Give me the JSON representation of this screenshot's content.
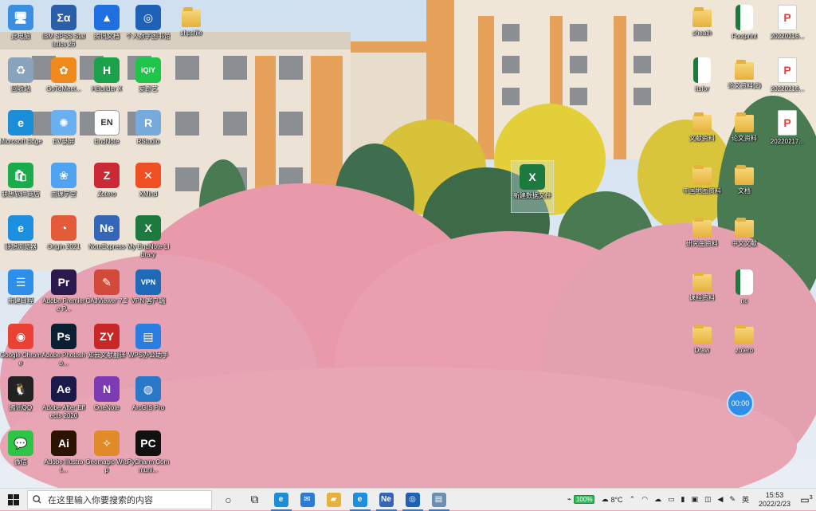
{
  "desktop": {
    "icons": [
      {
        "label": "此电脑",
        "glyph": "🖥",
        "color": "#3b8fe0",
        "selected": false
      },
      {
        "label": "IBM SPSS Statistics 26",
        "glyph": "Σα",
        "color": "#2a5fa8",
        "selected": false
      },
      {
        "label": "腾讯文档",
        "glyph": "▲",
        "color": "#1e6fe0",
        "selected": false
      },
      {
        "label": "个人数字图书馆",
        "glyph": "◎",
        "color": "#1d62b6",
        "selected": false
      },
      {
        "label": "shpsfile",
        "glyph": "",
        "color": "#e6b13c",
        "selected": false
      },
      {
        "label": "回收站",
        "glyph": "♻",
        "color": "#8aa3bd",
        "selected": false
      },
      {
        "label": "GoToMeet...",
        "glyph": "✿",
        "color": "#f08a1c",
        "selected": false
      },
      {
        "label": "HBuilder X",
        "glyph": "H",
        "color": "#1aa14a",
        "selected": false
      },
      {
        "label": "爱奇艺",
        "glyph": "iQIY",
        "color": "#1fc44b",
        "selected": false
      },
      {
        "label": "Microsoft Edge",
        "glyph": "e",
        "color": "#1c8ed8",
        "selected": false
      },
      {
        "label": "EV录屏",
        "glyph": "✺",
        "color": "#6ab0f0",
        "selected": false
      },
      {
        "label": "EndNote",
        "glyph": "EN",
        "color": "#ffffff",
        "selected": false
      },
      {
        "label": "RStudio",
        "glyph": "R",
        "color": "#75aadb",
        "selected": false
      },
      {
        "label": "联想软件商店",
        "glyph": "🛍",
        "color": "#1aab4c",
        "selected": false
      },
      {
        "label": "雨课学堂",
        "glyph": "❀",
        "color": "#4fa3f0",
        "selected": false
      },
      {
        "label": "Zotero",
        "glyph": "Z",
        "color": "#cc2936",
        "selected": false
      },
      {
        "label": "XMind",
        "glyph": "✕",
        "color": "#f04e23",
        "selected": false
      },
      {
        "label": "联想浏览器",
        "glyph": "e",
        "color": "#1d8fe0",
        "selected": false
      },
      {
        "label": "Origin 2021",
        "glyph": "◔",
        "color": "#e45b3a",
        "selected": false
      },
      {
        "label": "NoteExpress",
        "glyph": "Ne",
        "color": "#3466b8",
        "selected": false
      },
      {
        "label": "My EndNote Library",
        "glyph": "X",
        "color": "#1d7a3f",
        "selected": false
      },
      {
        "label": "新建日程",
        "glyph": "☰",
        "color": "#2d8fe8",
        "selected": false
      },
      {
        "label": "Adobe Premiere P...",
        "glyph": "Pr",
        "color": "#2b1a4d",
        "selected": false
      },
      {
        "label": "CAJViewer 7.2",
        "glyph": "✎",
        "color": "#d24a3a",
        "selected": false
      },
      {
        "label": "VPN 客户端",
        "glyph": "VPN",
        "color": "#1f6ab8",
        "selected": false
      },
      {
        "label": "Google Chrome",
        "glyph": "◉",
        "color": "#e94235",
        "selected": false
      },
      {
        "label": "Adobe Photosho...",
        "glyph": "Ps",
        "color": "#0b1f33",
        "selected": false
      },
      {
        "label": "知云文献翻译",
        "glyph": "ZY",
        "color": "#c62828",
        "selected": false
      },
      {
        "label": "WPS办公助手",
        "glyph": "▤",
        "color": "#2a7de1",
        "selected": false
      },
      {
        "label": "腾讯QQ",
        "glyph": "🐧",
        "color": "#222222",
        "selected": false
      },
      {
        "label": "Adobe After Effects 2020",
        "glyph": "Ae",
        "color": "#1a1a4a",
        "selected": false
      },
      {
        "label": "OneNote",
        "glyph": "N",
        "color": "#7c3bb3",
        "selected": false
      },
      {
        "label": "ArcGIS Pro",
        "glyph": "◍",
        "color": "#2a78c8",
        "selected": false
      },
      {
        "label": "微信",
        "glyph": "💬",
        "color": "#2ec448",
        "selected": false
      },
      {
        "label": "Adobe Illustrat...",
        "glyph": "Ai",
        "color": "#2a1400",
        "selected": false
      },
      {
        "label": "Geomagic Wrap",
        "glyph": "✧",
        "color": "#e08a2a",
        "selected": false
      },
      {
        "label": "PyCharm Communi...",
        "glyph": "PC",
        "color": "#111111",
        "selected": false
      },
      {
        "label": "新建数据文件",
        "glyph": "X",
        "color": "#1d7a3f",
        "selected": true
      },
      {
        "label": "sheath",
        "glyph": "",
        "color": "#e6b13c",
        "selected": false
      },
      {
        "label": "Footprint",
        "glyph": "",
        "color": "#1d7a3f",
        "selected": false
      },
      {
        "label": "20220216...",
        "glyph": "P",
        "color": "#d9433b",
        "selected": false
      },
      {
        "label": "Itsfor",
        "glyph": "",
        "color": "#1d7a3f",
        "selected": false
      },
      {
        "label": "论文资料(2)",
        "glyph": "",
        "color": "#e6b13c",
        "selected": false
      },
      {
        "label": "20220216...",
        "glyph": "P",
        "color": "#d9433b",
        "selected": false
      },
      {
        "label": "文献资料",
        "glyph": "",
        "color": "#e6b13c",
        "selected": false
      },
      {
        "label": "论文资料",
        "glyph": "",
        "color": "#e6b13c",
        "selected": false
      },
      {
        "label": "20220217...",
        "glyph": "P",
        "color": "#d9433b",
        "selected": false
      },
      {
        "label": "中国地图资料",
        "glyph": "",
        "color": "#e6b13c",
        "selected": false
      },
      {
        "label": "文档",
        "glyph": "",
        "color": "#e6b13c",
        "selected": false
      },
      {
        "label": "研究生资料",
        "glyph": "",
        "color": "#e6b13c",
        "selected": false
      },
      {
        "label": "中文文献",
        "glyph": "",
        "color": "#e6b13c",
        "selected": false
      },
      {
        "label": "课程资料",
        "glyph": "",
        "color": "#e6b13c",
        "selected": false
      },
      {
        "label": "nc",
        "glyph": "",
        "color": "#1d7a3f",
        "selected": false
      },
      {
        "label": "Draw",
        "glyph": "",
        "color": "#e6b13c",
        "selected": false
      },
      {
        "label": "zotero",
        "glyph": "",
        "color": "#e6b13c",
        "selected": false
      }
    ]
  },
  "timer": {
    "value": "00:00"
  },
  "taskbar": {
    "search_placeholder": "在这里输入你要搜索的内容",
    "apps": [
      {
        "name": "cortana",
        "glyph": "○",
        "color": "#222222"
      },
      {
        "name": "task-view",
        "glyph": "⧉",
        "color": "#222222"
      },
      {
        "name": "edge",
        "glyph": "e",
        "color": "#1c8ed8"
      },
      {
        "name": "mail",
        "glyph": "✉",
        "color": "#2b7bd6"
      },
      {
        "name": "file-explorer",
        "glyph": "▰",
        "color": "#e6b13c"
      },
      {
        "name": "lenovo-browser",
        "glyph": "e",
        "color": "#1d8fe0"
      },
      {
        "name": "noteexpress",
        "glyph": "Ne",
        "color": "#3466b8"
      },
      {
        "name": "digital-library",
        "glyph": "◎",
        "color": "#1d62b6"
      },
      {
        "name": "notepad",
        "glyph": "▤",
        "color": "#6c8fb0"
      }
    ],
    "battery": "100%",
    "weather": "8°C",
    "ime": "英",
    "time": "15:53",
    "date": "2022/2/23",
    "notifications": "3"
  }
}
